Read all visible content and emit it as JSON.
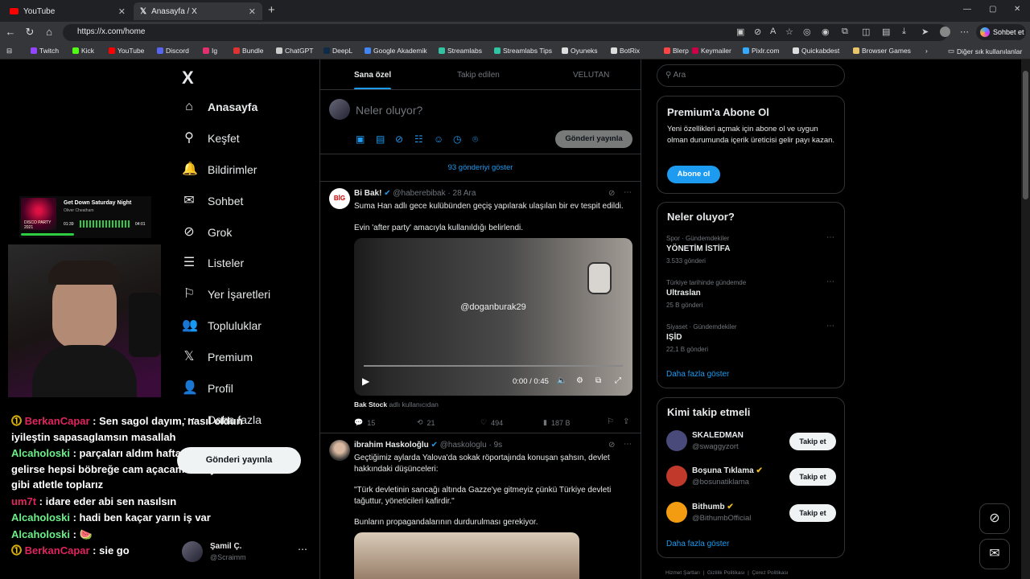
{
  "browser": {
    "tabs": [
      {
        "title": "YouTube"
      },
      {
        "title": "Anasayfa / X"
      }
    ],
    "new_tab": "+",
    "url": "https://x.com/home",
    "copilot_label": "Sohbet et",
    "window_controls": [
      "—",
      "▢",
      "✕"
    ],
    "bookmarks": [
      {
        "label": "Twitch",
        "color": "#9146ff"
      },
      {
        "label": "Kick",
        "color": "#53fc18"
      },
      {
        "label": "YouTube",
        "color": "#ff0000"
      },
      {
        "label": "Discord",
        "color": "#5865f2"
      },
      {
        "label": "Ig",
        "color": "#e1306c"
      },
      {
        "label": "Bundle",
        "color": "#d33"
      },
      {
        "label": "ChatGPT",
        "color": "#ccc"
      },
      {
        "label": "DeepL",
        "color": "#0f2b46"
      },
      {
        "label": "Google Akademik",
        "color": "#4285f4"
      },
      {
        "label": "Streamlabs",
        "color": "#31c3a2"
      },
      {
        "label": "Streamlabs Tips",
        "color": "#31c3a2"
      },
      {
        "label": "Oyuneks",
        "color": "#ddd"
      },
      {
        "label": "BotRix",
        "color": "#ddd"
      },
      {
        "label": "Blerp",
        "color": "#ff4444"
      },
      {
        "label": "Keymailer",
        "color": "#c04"
      },
      {
        "label": "Pixlr.com",
        "color": "#3af"
      },
      {
        "label": "Quickabdest",
        "color": "#ddd"
      },
      {
        "label": "Browser Games",
        "color": "#e8c46a"
      }
    ],
    "other_bookmarks": "Diğer sık kullanılanlar"
  },
  "overlay": {
    "song_title": "Get Down Saturday Night",
    "song_artist": "Oliver Cheatham",
    "song_time_current": "01:39",
    "song_time_total": "04:01",
    "album_label": "DISCO PARTY 2021",
    "chat": [
      {
        "user": "BerkanCapar",
        "color": "#e0245e",
        "badge": true,
        "text": "Sen sagol dayım, nasıl oldun iyileştin sapasaglamsın masallah"
      },
      {
        "user": "Alcaholoski",
        "color": "#6cf08a",
        "badge": false,
        "text": "parçaları aldım hafta sonuna gelirse hepsi böbreğe cam açacam henry cevil gibi atletle toplarız"
      },
      {
        "user": "um7t",
        "color": "#e0245e",
        "badge": false,
        "text": "idare eder abi sen nasılsın"
      },
      {
        "user": "Alcaholoski",
        "color": "#6cf08a",
        "badge": false,
        "text": "hadi ben kaçar yarın iş var"
      },
      {
        "user": "Alcaholoski",
        "color": "#6cf08a",
        "badge": false,
        "text": "🍉"
      },
      {
        "user": "BerkanCapar",
        "color": "#e0245e",
        "badge": true,
        "text": "sie go"
      }
    ]
  },
  "nav": {
    "logo": "X",
    "items": [
      {
        "label": "Anasayfa",
        "icon": "home-icon",
        "glyph": "⌂"
      },
      {
        "label": "Keşfet",
        "icon": "search-icon",
        "glyph": "⚲"
      },
      {
        "label": "Bildirimler",
        "icon": "bell-icon",
        "glyph": "🔔"
      },
      {
        "label": "Sohbet",
        "icon": "mail-icon",
        "glyph": "✉"
      },
      {
        "label": "Grok",
        "icon": "grok-icon",
        "glyph": "⊘"
      },
      {
        "label": "Listeler",
        "icon": "list-icon",
        "glyph": "☰"
      },
      {
        "label": "Yer İşaretleri",
        "icon": "bookmark-icon",
        "glyph": "⚐"
      },
      {
        "label": "Topluluklar",
        "icon": "people-icon",
        "glyph": "👥"
      },
      {
        "label": "Premium",
        "icon": "x-icon",
        "glyph": "𝕏"
      },
      {
        "label": "Profil",
        "icon": "person-icon",
        "glyph": "👤"
      },
      {
        "label": "Daha fazla",
        "icon": "more-circle-icon",
        "glyph": "⋯"
      }
    ],
    "post_button": "Gönderi yayınla",
    "account_name": "Şamil Ç.",
    "account_handle": "@Scraimm"
  },
  "feed": {
    "tabs": [
      "Sana özel",
      "Takip edilen",
      "VELUTAN"
    ],
    "compose_placeholder": "Neler oluyor?",
    "compose_button": "Gönderi yayınla",
    "show_posts": "93 gönderiyi göster",
    "tweets": [
      {
        "name": "Bi Bak!",
        "handle": "@haberebibak",
        "time": "28 Ara",
        "text1": "Suma Han adlı gece kulübünden geçiş yapılarak ulaşılan bir ev tespit edildi.",
        "text2": "Evin 'after party' amacıyla kullanıldığı belirlendi.",
        "video_watermark": "@doganburak29",
        "video_time": "0:00 / 0:45",
        "video_progress": 0,
        "source_name": "Bak Stock",
        "source_suffix": "adlı kullanıcıdan",
        "replies": "15",
        "reposts": "21",
        "likes": "494",
        "views": "187 B"
      },
      {
        "name": "ibrahim Haskoloğlu",
        "handle": "@haskologlu",
        "time": "9s",
        "text1": "Geçtiğimiz aylarda Yalova'da sokak röportajında konuşan şahsın, devlet hakkındaki düşünceleri:",
        "text2": "\"Türk devletinin sancağı altında Gazze'ye gitmeyiz çünkü Türkiye devleti tağuttur, yöneticileri kafirdir.\"",
        "text3": "Bunların propagandalarının durdurulması gerekiyor."
      }
    ]
  },
  "sidebar": {
    "search_placeholder": "Ara",
    "premium": {
      "title": "Premium'a Abone Ol",
      "body": "Yeni özellikleri açmak için abone ol ve uygun olman durumunda içerik üreticisi gelir payı kazan.",
      "button": "Abone ol"
    },
    "trends": {
      "title": "Neler oluyor?",
      "items": [
        {
          "category": "Spor · Gündemdekiler",
          "title": "YÖNETİM İSTİFA",
          "count": "3.533 gönderi"
        },
        {
          "category": "Türkiye tarihinde gündemde",
          "title": "Ultraslan",
          "count": "25 B gönderi"
        },
        {
          "category": "Siyaset · Gündemdekiler",
          "title": "IŞİD",
          "count": "22,1 B gönderi"
        }
      ],
      "more": "Daha fazla göster"
    },
    "who_to_follow": {
      "title": "Kimi takip etmeli",
      "items": [
        {
          "name": "SKALEDMAN",
          "handle": "@swaggyzort",
          "verified": false,
          "button": "Takip et",
          "avatar": "#4a4a7a"
        },
        {
          "name": "Boşuna Tıklama",
          "handle": "@bosunatiklama",
          "verified": true,
          "button": "Takip et",
          "avatar": "#c0392b"
        },
        {
          "name": "Bithumb",
          "handle": "@BithumbOfficial",
          "verified": true,
          "button": "Takip et",
          "avatar": "#f39c12"
        }
      ],
      "more": "Daha fazla göster"
    },
    "footer": [
      "Hizmet Şartları",
      "Gizlilik Politikası",
      "Çerez Politikası"
    ]
  },
  "colors": {
    "accent": "#1d9bf0",
    "background": "#000000",
    "border": "#2f3336",
    "muted": "#71767b"
  }
}
